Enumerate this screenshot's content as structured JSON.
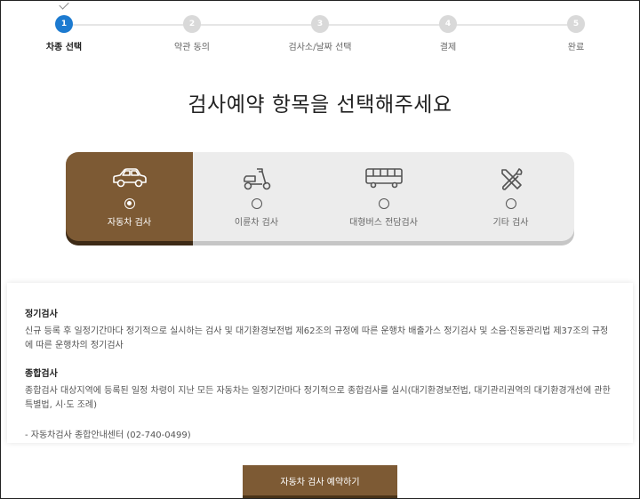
{
  "stepper": {
    "steps": [
      {
        "number": "1",
        "label": "차종 선택"
      },
      {
        "number": "2",
        "label": "약관 동의"
      },
      {
        "number": "3",
        "label": "검사소/날짜 선택"
      },
      {
        "number": "4",
        "label": "결제"
      },
      {
        "number": "5",
        "label": "완료"
      }
    ],
    "active_index": 0,
    "active_color": "#1c7ad0"
  },
  "page_title": "검사예약 항목을 선택해주세요",
  "tabs": {
    "items": [
      {
        "icon": "car-icon",
        "label": "자동차 검사",
        "selected": true
      },
      {
        "icon": "scooter-icon",
        "label": "이륜차 검사",
        "selected": false
      },
      {
        "icon": "bus-icon",
        "label": "대형버스 전담검사",
        "selected": false
      },
      {
        "icon": "tools-icon",
        "label": "기타 검사",
        "selected": false
      }
    ],
    "active_color": "#7d5a34"
  },
  "info": {
    "section1": {
      "title": "정기검사",
      "body": "신규 등록 후 일정기간마다 정기적으로 실시하는 검사 및 대기환경보전법 제62조의 규정에 따른 운행차 배출가스 정기검사 및 소음·진동관리법 제37조의 규정에 따른 운행차의 정기검사"
    },
    "section2": {
      "title": "종합검사",
      "body": "종합검사 대상지역에 등록된 일정 차령이 지난 모든 자동차는 일정기간마다 정기적으로 종합검사를 실시(대기환경보전법, 대기관리권역의 대기환경개선에 관한 특별법, 시·도 조례)"
    },
    "contact": "- 자동차검사 종합안내센터 (02-740-0499)"
  },
  "reserve_button": {
    "label": "자동차 검사 예약하기"
  }
}
